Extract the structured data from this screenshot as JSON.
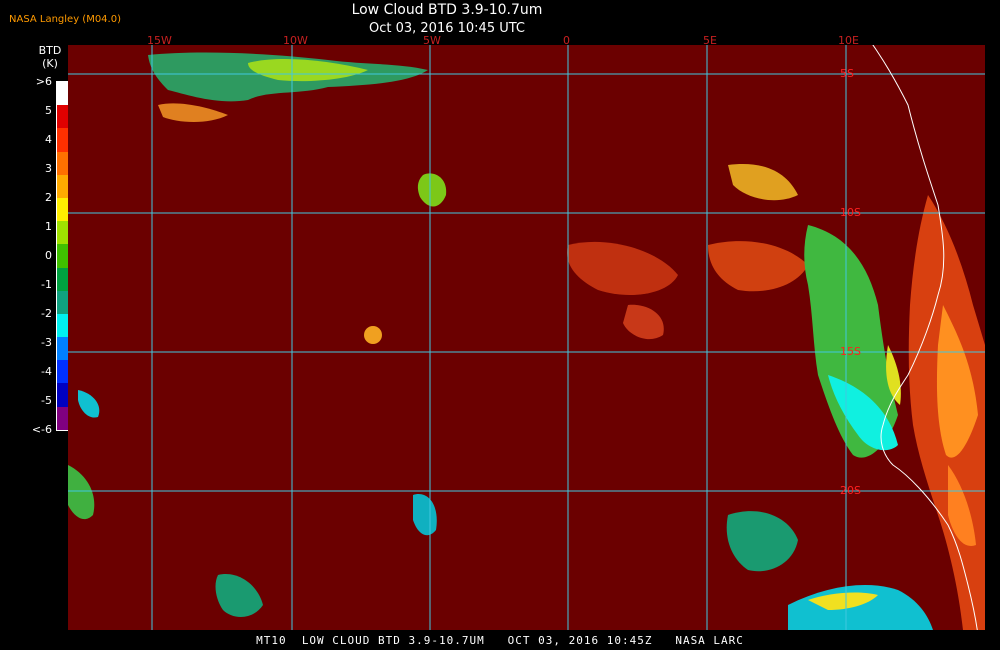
{
  "header": {
    "title": "Low Cloud BTD 3.9-10.7um",
    "subtitle": "Oct 03, 2016 10:45 UTC",
    "agency": "NASA Langley (M04.0)"
  },
  "colorbar": {
    "title_line1": "BTD",
    "title_line2": "(K)",
    "labels": [
      ">6",
      "5",
      "4",
      "3",
      "2",
      "1",
      "0",
      "-1",
      "-2",
      "-3",
      "-4",
      "-5",
      "<-6"
    ],
    "colors": [
      "#ffffff",
      "#e00000",
      "#ff3000",
      "#ff7000",
      "#ffaa00",
      "#ffee00",
      "#a0e000",
      "#40c000",
      "#00a040",
      "#10a080",
      "#00f0f0",
      "#0080ff",
      "#0030ff",
      "#0000c0",
      "#800080"
    ]
  },
  "grid": {
    "lon_labels": [
      "15W",
      "10W",
      "5W",
      "0",
      "5E",
      "10E"
    ],
    "lat_labels": [
      "5S",
      "10S",
      "15S",
      "20S"
    ]
  },
  "map": {
    "background_color": "#6b0000",
    "grid_color": "#40c8e0",
    "coast_color": "#ffffff"
  },
  "footer": {
    "text": "MT10  LOW CLOUD BTD 3.9-10.7UM   OCT 03, 2016 10:45Z   NASA LARC"
  }
}
